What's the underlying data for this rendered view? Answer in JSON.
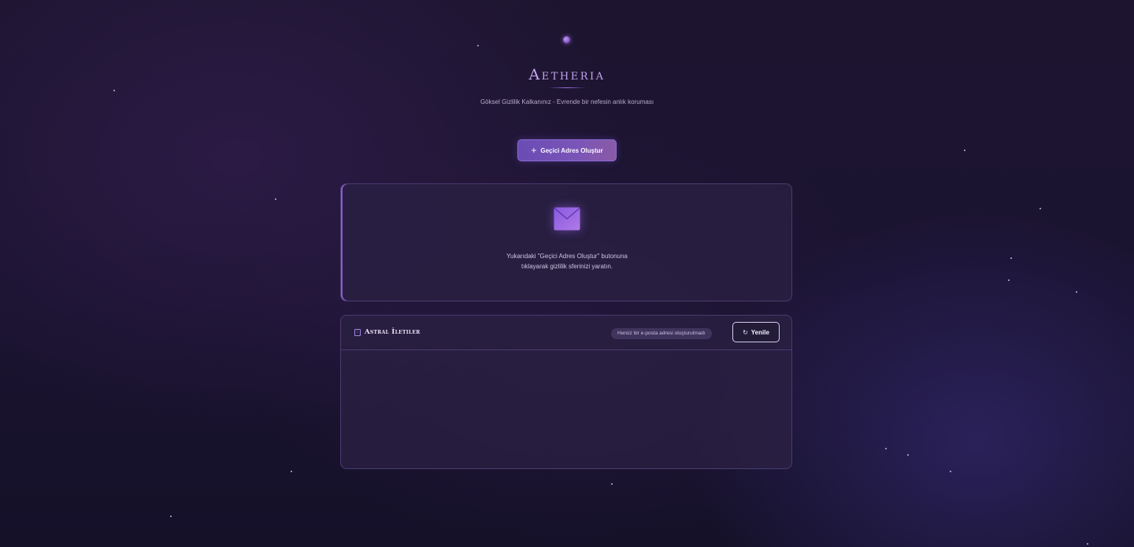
{
  "brand": {
    "logo": "Aetheria",
    "tagline": "Göksel Gizlilik Kalkanınız - Evrende bir nefesin anlık koruması"
  },
  "actions": {
    "generate_label": "Geçici Adres Oluştur",
    "generate_icon": "plus-icon"
  },
  "address_card": {
    "icon": "envelope-icon",
    "empty_line1": "Yukarıdaki \"Geçici Adres Oluştur\" butonuna",
    "empty_line2": "tıklayarak gizlilik sferinizi yaratın."
  },
  "inbox": {
    "icon": "inbox-icon",
    "title": "Astral İletiler",
    "status": "Henüz bir e-posta adresi oluşturulmadı",
    "refresh_label": "Yenile",
    "refresh_icon": "refresh-icon",
    "messages": []
  },
  "colors": {
    "accent": "#7a55b8",
    "background": "#1a1330",
    "card": "#2a2042"
  }
}
